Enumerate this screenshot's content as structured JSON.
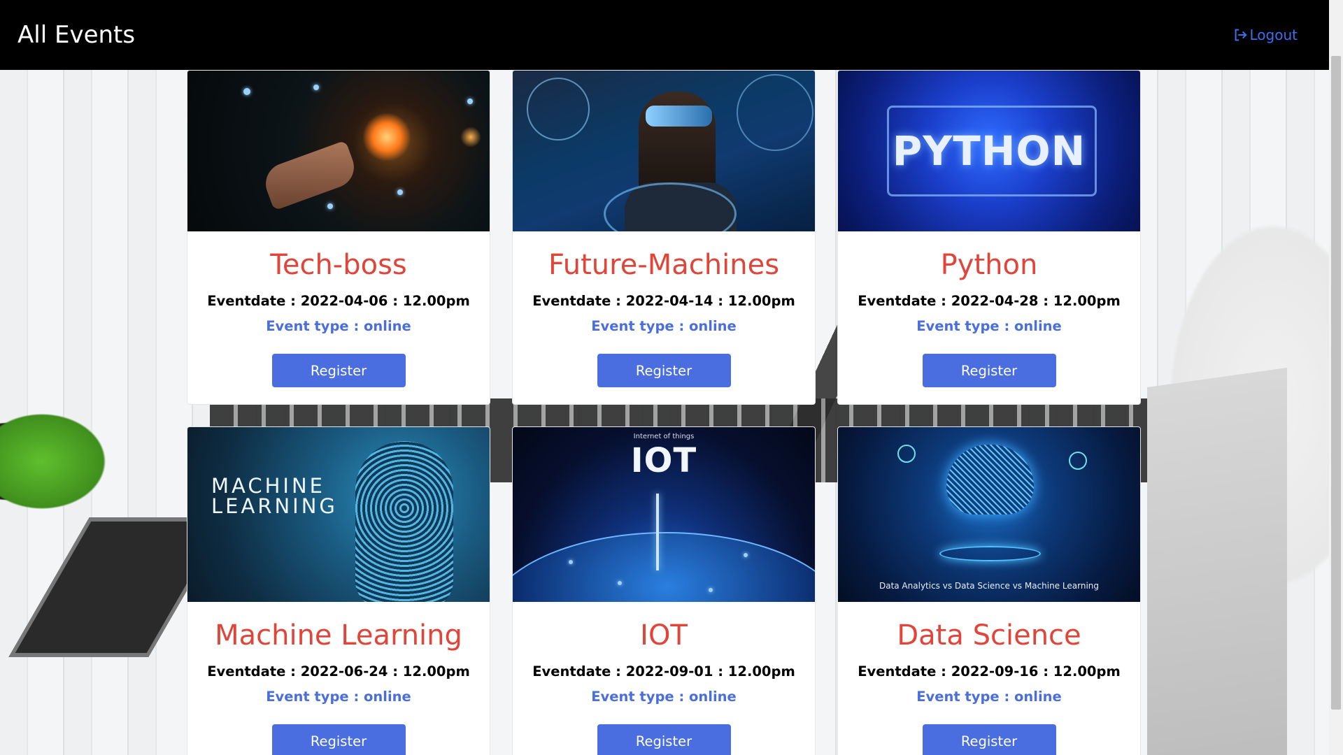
{
  "header": {
    "brand": "All Events",
    "logout_label": "Logout"
  },
  "colors": {
    "navbar": "#000000",
    "title_red": "#e0453a",
    "event_type_blue": "#4a6fdc",
    "button_blue": "#4a6ee0"
  },
  "events": [
    {
      "title": "Tech-boss",
      "date": "Eventdate : 2022-04-06 : 12.00pm",
      "type": "Event type : online",
      "button": "Register",
      "image": "network-hand-image"
    },
    {
      "title": "Future-Machines",
      "date": "Eventdate : 2022-04-14 : 12.00pm",
      "type": "Event type : online",
      "button": "Register",
      "image": "vr-headset-image"
    },
    {
      "title": "Python",
      "date": "Eventdate : 2022-04-28 : 12.00pm",
      "type": "Event type : online",
      "button": "Register",
      "image": "python-circuit-image",
      "image_text": "PYTHON"
    },
    {
      "title": "Machine Learning",
      "date": "Eventdate : 2022-06-24 : 12.00pm",
      "type": "Event type : online",
      "button": "Register",
      "image": "ml-head-image",
      "image_text": "MACHINE LEARNING"
    },
    {
      "title": "IOT",
      "date": "Eventdate : 2022-09-01 : 12.00pm",
      "type": "Event type : online",
      "button": "Register",
      "image": "iot-globe-image",
      "image_small_text": "Internet of things",
      "image_text": "IOT"
    },
    {
      "title": "Data Science",
      "date": "Eventdate : 2022-09-16 : 12.00pm",
      "type": "Event type : online",
      "button": "Register",
      "image": "brain-circuit-image",
      "image_caption": "Data Analytics vs Data Science vs Machine Learning"
    }
  ]
}
